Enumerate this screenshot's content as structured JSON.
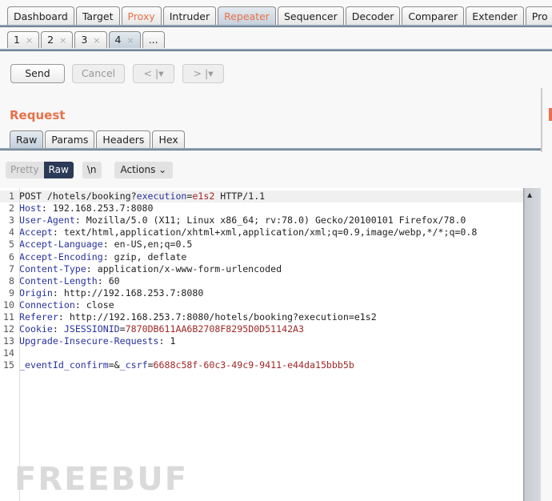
{
  "main_tabs": [
    {
      "label": "Dashboard"
    },
    {
      "label": "Target"
    },
    {
      "label": "Proxy",
      "color": "#e8704a"
    },
    {
      "label": "Intruder"
    },
    {
      "label": "Repeater",
      "color": "#e8704a",
      "selected": true
    },
    {
      "label": "Sequencer"
    },
    {
      "label": "Decoder"
    },
    {
      "label": "Comparer"
    },
    {
      "label": "Extender"
    },
    {
      "label": "Pro"
    }
  ],
  "repeater_tabs": [
    {
      "label": "1",
      "close": "×"
    },
    {
      "label": "2",
      "close": "×"
    },
    {
      "label": "3",
      "close": "×"
    },
    {
      "label": "4",
      "close": "×",
      "selected": true
    },
    {
      "label": "...",
      "close": ""
    }
  ],
  "toolbar": {
    "send": "Send",
    "cancel": "Cancel",
    "back": "< |▾",
    "forward": "> |▾"
  },
  "request": {
    "title": "Request",
    "title_color": "#e8704a",
    "tabs": [
      "Raw",
      "Params",
      "Headers",
      "Hex"
    ],
    "selected_tab": "Raw"
  },
  "view": {
    "pretty": "Pretty",
    "raw": "Raw",
    "newline": "\\n",
    "actions": "Actions ⌄"
  },
  "lines": [
    [
      [
        "s",
        "POST /hotels/booking?"
      ],
      [
        "n",
        "execution"
      ],
      [
        "s",
        "="
      ],
      [
        "r",
        "e1s2"
      ],
      [
        "s",
        " HTTP/1.1"
      ]
    ],
    [
      [
        "n",
        "Host"
      ],
      [
        "s",
        ": 192.168.253.7:8080"
      ]
    ],
    [
      [
        "n",
        "User-Agent"
      ],
      [
        "s",
        ": Mozilla/5.0 (X11; Linux x86_64; rv:78.0) Gecko/20100101 Firefox/78.0"
      ]
    ],
    [
      [
        "n",
        "Accept"
      ],
      [
        "s",
        ": text/html,application/xhtml+xml,application/xml;q=0.9,image/webp,*/*;q=0.8"
      ]
    ],
    [
      [
        "n",
        "Accept-Language"
      ],
      [
        "s",
        ": en-US,en;q=0.5"
      ]
    ],
    [
      [
        "n",
        "Accept-Encoding"
      ],
      [
        "s",
        ": gzip, deflate"
      ]
    ],
    [
      [
        "n",
        "Content-Type"
      ],
      [
        "s",
        ": application/x-www-form-urlencoded"
      ]
    ],
    [
      [
        "n",
        "Content-Length"
      ],
      [
        "s",
        ": 60"
      ]
    ],
    [
      [
        "n",
        "Origin"
      ],
      [
        "s",
        ": http://192.168.253.7:8080"
      ]
    ],
    [
      [
        "n",
        "Connection"
      ],
      [
        "s",
        ": close"
      ]
    ],
    [
      [
        "n",
        "Referer"
      ],
      [
        "s",
        ": http://192.168.253.7:8080/hotels/booking?execution=e1s2"
      ]
    ],
    [
      [
        "n",
        "Cookie"
      ],
      [
        "s",
        ": "
      ],
      [
        "n",
        "JSESSIONID"
      ],
      [
        "s",
        "="
      ],
      [
        "r",
        "7870DB611AA6B2708F8295D0D51142A3"
      ]
    ],
    [
      [
        "n",
        "Upgrade-Insecure-Requests"
      ],
      [
        "s",
        ": 1"
      ]
    ],
    [],
    [
      [
        "n",
        "_eventId_confirm"
      ],
      [
        "s",
        "=&"
      ],
      [
        "n",
        "_csrf"
      ],
      [
        "s",
        "="
      ],
      [
        "r",
        "6688c58f-60c3-49c9-9411-e44da15bbb5b"
      ]
    ]
  ],
  "watermark": "FREEBUF"
}
